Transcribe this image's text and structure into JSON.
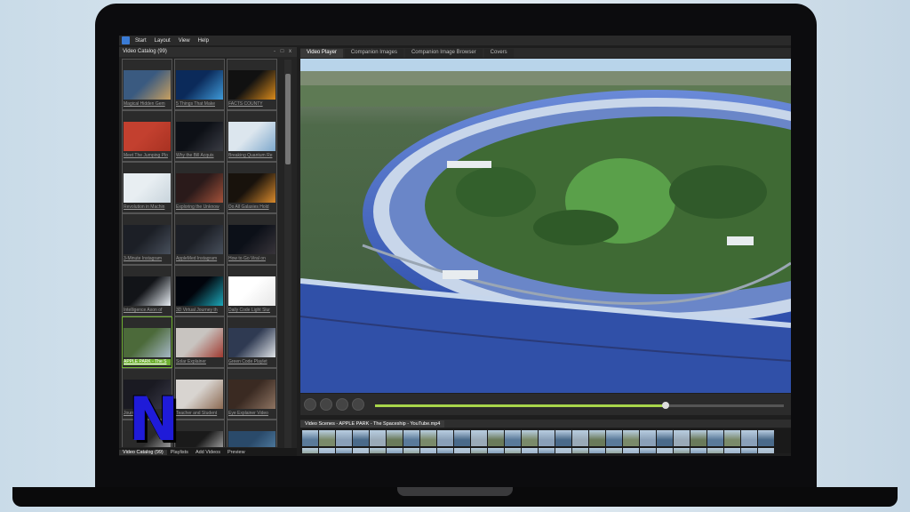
{
  "menubar": {
    "items": [
      "Start",
      "Layout",
      "View",
      "Help"
    ]
  },
  "left_panel": {
    "title": "Video Catalog (99)",
    "controls": "- □ x",
    "thumbnails": [
      {
        "label": "Magical Hidden Gem",
        "colors": [
          "#3a5a80",
          "#c8a060"
        ]
      },
      {
        "label": "5 Things That Make",
        "colors": [
          "#0b2a5a",
          "#3f9ad8"
        ]
      },
      {
        "label": "FACTS COUNTY",
        "colors": [
          "#111111",
          "#d98a1b"
        ]
      },
      {
        "label": "Meet The Jumping Plo",
        "colors": [
          "#c3402f",
          "#a83222"
        ]
      },
      {
        "label": "Why the Bill Acquis",
        "colors": [
          "#0d1016",
          "#3a3c44"
        ]
      },
      {
        "label": "Breaking Quantum Re",
        "colors": [
          "#dce6ee",
          "#7ea8cc"
        ]
      },
      {
        "label": "Revolution in Machin",
        "colors": [
          "#e8eef2",
          "#c8d4dc"
        ]
      },
      {
        "label": "Exploring the Unknow",
        "colors": [
          "#2a1a1a",
          "#a4523a"
        ]
      },
      {
        "label": "Do All Galaxies Hold",
        "colors": [
          "#18120c",
          "#d98a2c"
        ]
      },
      {
        "label": "3-Minute Instagram",
        "colors": [
          "#1c1f26",
          "#48505c"
        ]
      },
      {
        "label": "AppleMed Instagram",
        "colors": [
          "#1c1f26",
          "#48505c"
        ]
      },
      {
        "label": "How to Go Viral on",
        "colors": [
          "#0c1018",
          "#38343a"
        ]
      },
      {
        "label": "Intelligence Axon of",
        "colors": [
          "#121418",
          "#e8eef4"
        ]
      },
      {
        "label": "3D Virtual Journey th",
        "colors": [
          "#02050c",
          "#1ca6b8"
        ]
      },
      {
        "label": "Daily Code Light Slur",
        "colors": [
          "#ffffff",
          "#e6e6e6"
        ]
      },
      {
        "label": "APPLE PARK - The S",
        "colors": [
          "#4c6a3a",
          "#a6b8c6"
        ]
      },
      {
        "label": "Solar Explainer",
        "colors": [
          "#c8c4c0",
          "#a03a30"
        ]
      },
      {
        "label": "Green Code Playlet",
        "colors": [
          "#2f3a52",
          "#e0e4e8"
        ]
      },
      {
        "label": "Journey Mentor",
        "colors": [
          "#1a1a22",
          "#3a3a48"
        ]
      },
      {
        "label": "Teacher and Student",
        "colors": [
          "#d8d4d0",
          "#8c6a52"
        ]
      },
      {
        "label": "Eye Explainer Video",
        "colors": [
          "#3a2a22",
          "#8e7462"
        ]
      },
      {
        "label": "",
        "colors": [
          "#2a2a2a",
          "#cfcfcf"
        ]
      },
      {
        "label": "",
        "colors": [
          "#1a1a1a",
          "#cfcfcf"
        ]
      },
      {
        "label": "",
        "colors": [
          "#2a4a6a",
          "#5a8ab0"
        ]
      }
    ],
    "bottom_tabs": [
      "Video Catalog (99)",
      "Playlists",
      "Add Videos",
      "Preview"
    ]
  },
  "logo": {
    "text": "N"
  },
  "right_panel": {
    "tabs": [
      "Video Player",
      "Companion Images",
      "Companion Image Browser",
      "Covers"
    ],
    "seek_progress": 0.71,
    "scenes_title": "Video Scenes - APPLE PARK - The Spaceship - YouTube.mp4"
  }
}
